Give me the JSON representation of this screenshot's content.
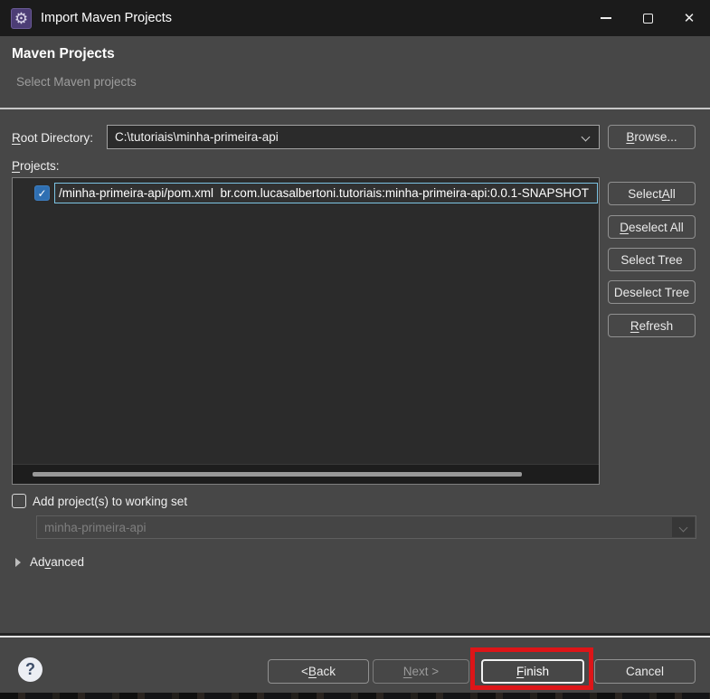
{
  "window": {
    "title": "Import Maven Projects"
  },
  "icons": {
    "app_icon": "gear",
    "app_icon_glyph": "⚙",
    "minimize": "minimize-dash",
    "maximize": "maximize-square",
    "close_glyph": "✕",
    "checkmark_glyph": "✓",
    "help_glyph": "?"
  },
  "header": {
    "title": "Maven Projects",
    "subtitle": "Select Maven projects"
  },
  "form": {
    "root_directory": {
      "label": "Root Directory:",
      "mnemonic_index": 0,
      "value": "C:\\tutoriais\\minha-primeira-api"
    },
    "browse_button": {
      "label": "Browse...",
      "mnemonic_index": 0
    },
    "projects_label": {
      "label": "Projects:",
      "mnemonic_index": 0
    },
    "project_list": [
      {
        "checked": true,
        "selected": true,
        "text": "/minha-primeira-api/pom.xml  br.com.lucasalbertoni.tutoriais:minha-primeira-api:0.0.1-SNAPSHOT"
      }
    ],
    "side_buttons": [
      {
        "label": "Select All",
        "mnemonic_index": 7
      },
      {
        "label": "Deselect All",
        "mnemonic_index": 0
      },
      {
        "label": "Select Tree",
        "mnemonic_index": -1
      },
      {
        "label": "Deselect Tree",
        "mnemonic_index": -1
      },
      {
        "label": "Refresh",
        "mnemonic_index": 0
      }
    ],
    "working_set": {
      "checkbox_label": "Add project(s) to working set",
      "checked": false,
      "combo_value": "minha-primeira-api",
      "combo_enabled": false
    },
    "advanced": {
      "label": "Advanced",
      "mnemonic_index": 2,
      "expanded": false
    }
  },
  "footer": {
    "help_glyph": "?",
    "buttons": [
      {
        "label": "< Back",
        "mnemonic_index": 2,
        "enabled": true
      },
      {
        "label": "Next >",
        "mnemonic_index": 0,
        "enabled": false
      },
      {
        "label": "Finish",
        "mnemonic_index": 0,
        "enabled": true,
        "default": true,
        "annotated": true
      },
      {
        "label": "Cancel",
        "mnemonic_index": -1,
        "enabled": true
      }
    ]
  },
  "colors": {
    "titlebar_bg": "#1b1b1b",
    "dialog_bg": "#474747",
    "list_bg": "#2b2b2b",
    "checkbox_accent": "#2f6fb2",
    "selection_border": "#7cc4e4",
    "annotation_red": "#dd1518",
    "default_button_border": "#f2f2f2"
  }
}
